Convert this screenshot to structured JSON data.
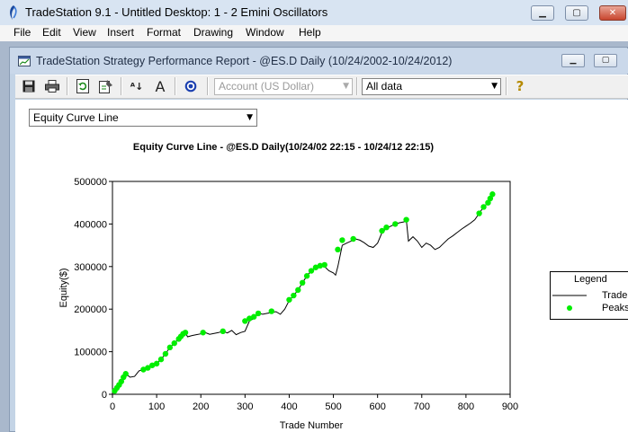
{
  "app": {
    "title": "TradeStation 9.1 - Untitled Desktop: 1 - 2 Emini Oscillators",
    "menu": [
      "File",
      "Edit",
      "View",
      "Insert",
      "Format",
      "Drawing",
      "Window",
      "Help"
    ]
  },
  "document": {
    "title": "TradeStation Strategy Performance Report - @ES.D Daily (10/24/2002-10/24/2012)"
  },
  "toolbar": {
    "account_combo": "Account (US Dollar)",
    "range_combo": "All data",
    "help_glyph": "?"
  },
  "view_select": "Equity Curve Line",
  "icons": [
    "app-logo-icon",
    "document-icon",
    "save-icon",
    "print-icon",
    "refresh-icon",
    "settings-icon",
    "decrease-font-icon",
    "increase-font-icon",
    "target-icon",
    "help-icon",
    "dropdown-arrow-icon"
  ],
  "colors": {
    "peaks": "#00ee00",
    "line": "#000000",
    "titlebar": "#d8e4f2",
    "mdi": "#a9b8cc"
  },
  "chart_data": {
    "type": "line",
    "title": "Equity Curve Line - @ES.D Daily(10/24/02 22:15 - 10/24/12 22:15)",
    "xlabel": "Trade Number",
    "ylabel": "Equity($)",
    "xlim": [
      0,
      900
    ],
    "ylim": [
      0,
      500000
    ],
    "x_ticks": [
      "0",
      "100",
      "200",
      "300",
      "400",
      "500",
      "600",
      "700",
      "800",
      "900"
    ],
    "y_ticks": [
      "0",
      "100000",
      "200000",
      "300000",
      "400000",
      "500000"
    ],
    "grid": true,
    "legend": {
      "title": "Legend",
      "placement": "right",
      "entries": [
        "Trade",
        "Peaks"
      ]
    },
    "series": [
      {
        "name": "Trade",
        "x": [
          0,
          10,
          20,
          30,
          40,
          50,
          60,
          70,
          80,
          90,
          100,
          110,
          120,
          130,
          140,
          150,
          160,
          165,
          170,
          180,
          190,
          200,
          210,
          220,
          230,
          240,
          250,
          260,
          270,
          280,
          290,
          300,
          310,
          320,
          330,
          340,
          350,
          360,
          370,
          380,
          390,
          400,
          410,
          420,
          430,
          440,
          450,
          460,
          470,
          480,
          490,
          500,
          505,
          510,
          520,
          530,
          540,
          550,
          560,
          570,
          580,
          590,
          600,
          610,
          620,
          630,
          640,
          650,
          660,
          665,
          670,
          680,
          690,
          700,
          710,
          720,
          730,
          740,
          750,
          760,
          770,
          780,
          790,
          800,
          810,
          820,
          830,
          840,
          850,
          860
        ],
        "y": [
          5000,
          15000,
          30000,
          48000,
          40000,
          42000,
          55000,
          58000,
          62000,
          68000,
          72000,
          82000,
          95000,
          110000,
          120000,
          130000,
          142000,
          145000,
          135000,
          138000,
          140000,
          142000,
          145000,
          141000,
          143000,
          145000,
          148000,
          144000,
          150000,
          140000,
          145000,
          148000,
          172000,
          178000,
          190000,
          188000,
          190000,
          192000,
          194000,
          188000,
          200000,
          220000,
          232000,
          245000,
          262000,
          278000,
          290000,
          298000,
          302000,
          300000,
          290000,
          285000,
          280000,
          300000,
          350000,
          355000,
          360000,
          365000,
          362000,
          356000,
          348000,
          345000,
          355000,
          380000,
          390000,
          395000,
          400000,
          403000,
          405000,
          410000,
          360000,
          370000,
          360000,
          345000,
          355000,
          350000,
          340000,
          345000,
          355000,
          365000,
          372000,
          380000,
          388000,
          395000,
          402000,
          410000,
          425000,
          440000,
          450000,
          470000
        ]
      },
      {
        "name": "Peaks",
        "x": [
          5,
          10,
          15,
          20,
          25,
          30,
          70,
          80,
          90,
          100,
          110,
          120,
          130,
          140,
          150,
          155,
          160,
          165,
          205,
          250,
          300,
          310,
          320,
          330,
          360,
          400,
          410,
          420,
          430,
          440,
          450,
          460,
          470,
          480,
          510,
          520,
          545,
          610,
          620,
          640,
          665,
          830,
          840,
          850,
          855,
          860
        ],
        "y": [
          8000,
          15000,
          22000,
          30000,
          40000,
          48000,
          58000,
          62000,
          68000,
          72000,
          82000,
          95000,
          110000,
          120000,
          130000,
          136000,
          142000,
          145000,
          145000,
          148000,
          172000,
          178000,
          182000,
          190000,
          195000,
          222000,
          232000,
          245000,
          262000,
          278000,
          290000,
          298000,
          302000,
          304000,
          340000,
          362000,
          365000,
          384000,
          392000,
          400000,
          410000,
          425000,
          440000,
          450000,
          460000,
          470000
        ]
      }
    ]
  }
}
